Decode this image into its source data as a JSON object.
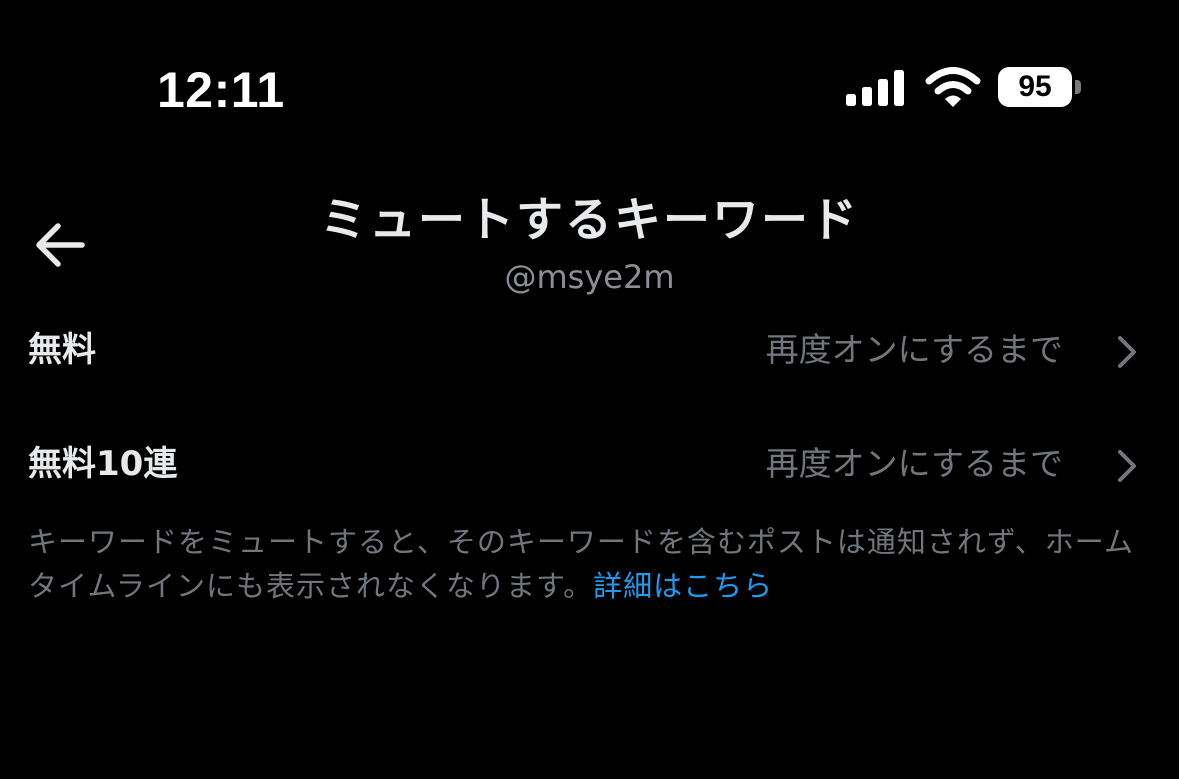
{
  "status_bar": {
    "time": "12:11",
    "battery_level": "95",
    "icons": [
      "signal-icon",
      "wifi-icon",
      "battery-icon"
    ]
  },
  "header": {
    "back_icon": "arrow-left-icon",
    "title": "ミュートするキーワード",
    "subtitle": "@msye2m"
  },
  "keywords": [
    {
      "label": "無料",
      "duration": "再度オンにするまで",
      "icon": "chevron-right-icon"
    },
    {
      "label": "無料10連",
      "duration": "再度オンにするまで",
      "icon": "chevron-right-icon"
    }
  ],
  "description": {
    "text": "キーワードをミュートすると、そのキーワードを含むポストは通知されず、ホームタイムラインにも表示されなくなります。",
    "link_label": "詳細はこちら"
  },
  "colors": {
    "background": "#000000",
    "primary_text": "#e7e9ea",
    "secondary_text": "#71767b",
    "accent": "#1d9bf0"
  }
}
